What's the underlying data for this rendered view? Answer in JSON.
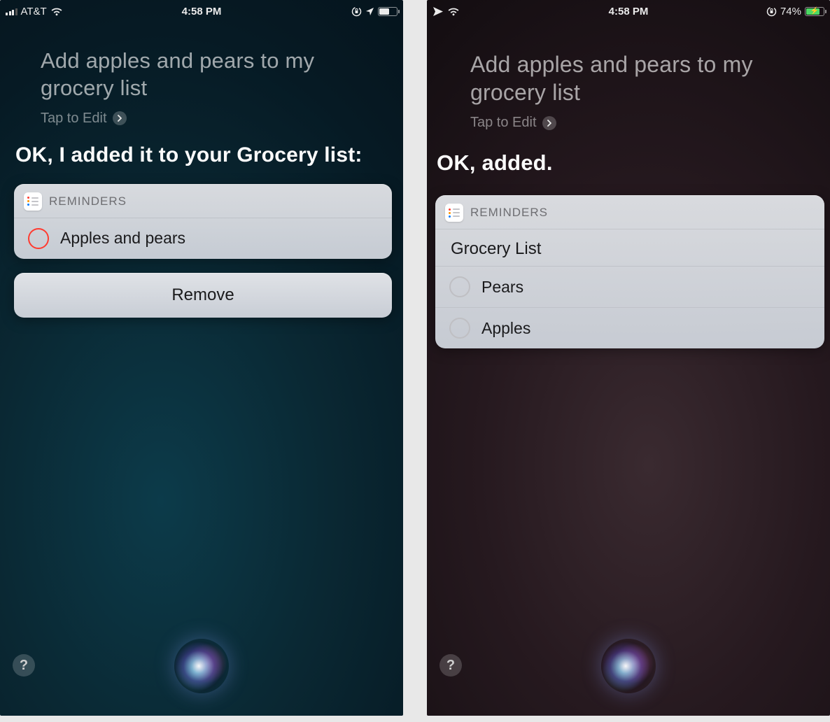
{
  "left": {
    "status": {
      "carrier": "AT&T",
      "time": "4:58 PM"
    },
    "user_request": "Add apples and pears to my grocery list",
    "tap_to_edit": "Tap to Edit",
    "siri_response": "OK, I added it to your Grocery list:",
    "reminders": {
      "app_label": "REMINDERS",
      "items": [
        {
          "label": "Apples and pears"
        }
      ]
    },
    "remove_label": "Remove",
    "help_label": "?"
  },
  "right": {
    "status": {
      "time": "4:58 PM",
      "battery_pct": "74%"
    },
    "user_request": "Add apples and pears to my grocery list",
    "tap_to_edit": "Tap to Edit",
    "siri_response": "OK, added.",
    "reminders": {
      "app_label": "REMINDERS",
      "list_title": "Grocery List",
      "items": [
        {
          "label": "Pears"
        },
        {
          "label": "Apples"
        }
      ]
    },
    "help_label": "?"
  }
}
